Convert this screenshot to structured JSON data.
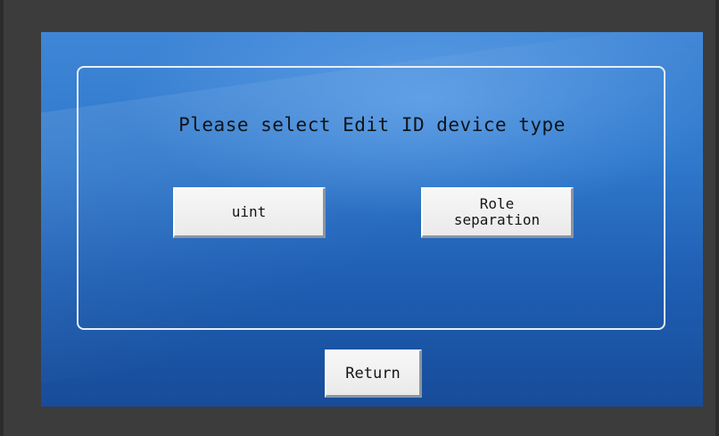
{
  "dialog": {
    "prompt": "Please select Edit ID device type",
    "buttons": {
      "uint_label": "uint",
      "role_label": "Role\nseparation"
    },
    "return_label": "Return"
  },
  "colors": {
    "screen_top": "#3f86d6",
    "screen_bottom": "#174c99",
    "frame": "#3c3c3c",
    "panel_border": "#e8eef6",
    "button_face": "#f0f0f0"
  }
}
